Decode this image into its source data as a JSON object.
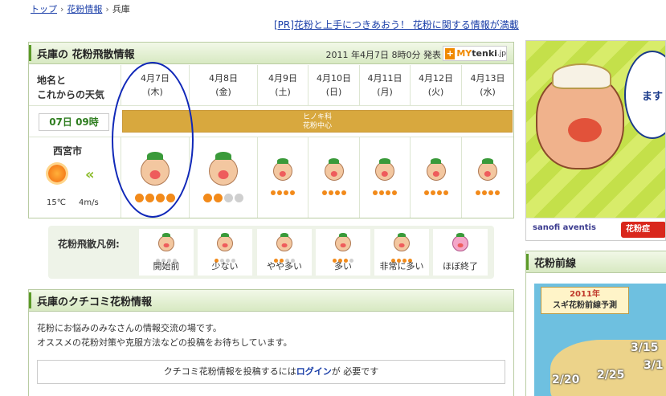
{
  "breadcrumb": {
    "top": "トップ",
    "section": "花粉情報",
    "current": "兵庫"
  },
  "pr_link": "[PR]花粉と上手につきあおう！ 花粉に関する情報が満載",
  "forecast": {
    "title": "兵庫の 花粉飛散情報",
    "issued": "2011 年4月7日 8時0分 発表",
    "mytenki": {
      "my": "MY",
      "tenki": "tenki",
      "jp": ".jp"
    },
    "row_label_line1": "地名と",
    "row_label_line2": "これからの天気",
    "time_badge": "07日 09時",
    "hinoki_line1": "ヒノキ科",
    "hinoki_line2": "花粉中心",
    "days": [
      {
        "date": "4月7日",
        "wd": "(木)"
      },
      {
        "date": "4月8日",
        "wd": "(金)"
      },
      {
        "date": "4月9日",
        "wd": "(土)"
      },
      {
        "date": "4月10日",
        "wd": "(日)"
      },
      {
        "date": "4月11日",
        "wd": "(月)"
      },
      {
        "date": "4月12日",
        "wd": "(火)"
      },
      {
        "date": "4月13日",
        "wd": "(水)"
      }
    ],
    "levels": [
      4,
      2,
      4,
      4,
      4,
      4,
      4
    ],
    "city": "西宮市",
    "temp": "15℃",
    "wind": "4m/s"
  },
  "legend": {
    "title": "花粉飛散凡例:",
    "items": [
      {
        "label": "開始前",
        "level": 0
      },
      {
        "label": "少ない",
        "level": 1
      },
      {
        "label": "やや多い",
        "level": 2
      },
      {
        "label": "多い",
        "level": 3
      },
      {
        "label": "非常に多い",
        "level": 4
      },
      {
        "label": "ほぼ終了",
        "level": 0
      }
    ]
  },
  "kuchikomi": {
    "title": "兵庫のクチコミ花粉情報",
    "line1": "花粉にお悩みのみなさんの情報交流の場です。",
    "line2": "オススメの花粉対策や克服方法などの投稿をお待ちしています。",
    "login_pre": "クチコミ花粉情報を投稿するには",
    "login_link": "ログイン",
    "login_post": "が 必要です"
  },
  "ad": {
    "bubble": "ます 胎",
    "sanofi": "sanofi aventis",
    "btn": "花粉症"
  },
  "zensen": {
    "title": "花粉前線",
    "map_title_line1": "2011年",
    "map_title_line2": "スギ花粉前線予測",
    "dates": [
      "3/15",
      "3/1",
      "2/25",
      "2/20"
    ]
  },
  "colors": {
    "accent_green": "#5b9a28",
    "pollen_orange": "#f28a1a",
    "highlight_blue": "#1028b8"
  }
}
